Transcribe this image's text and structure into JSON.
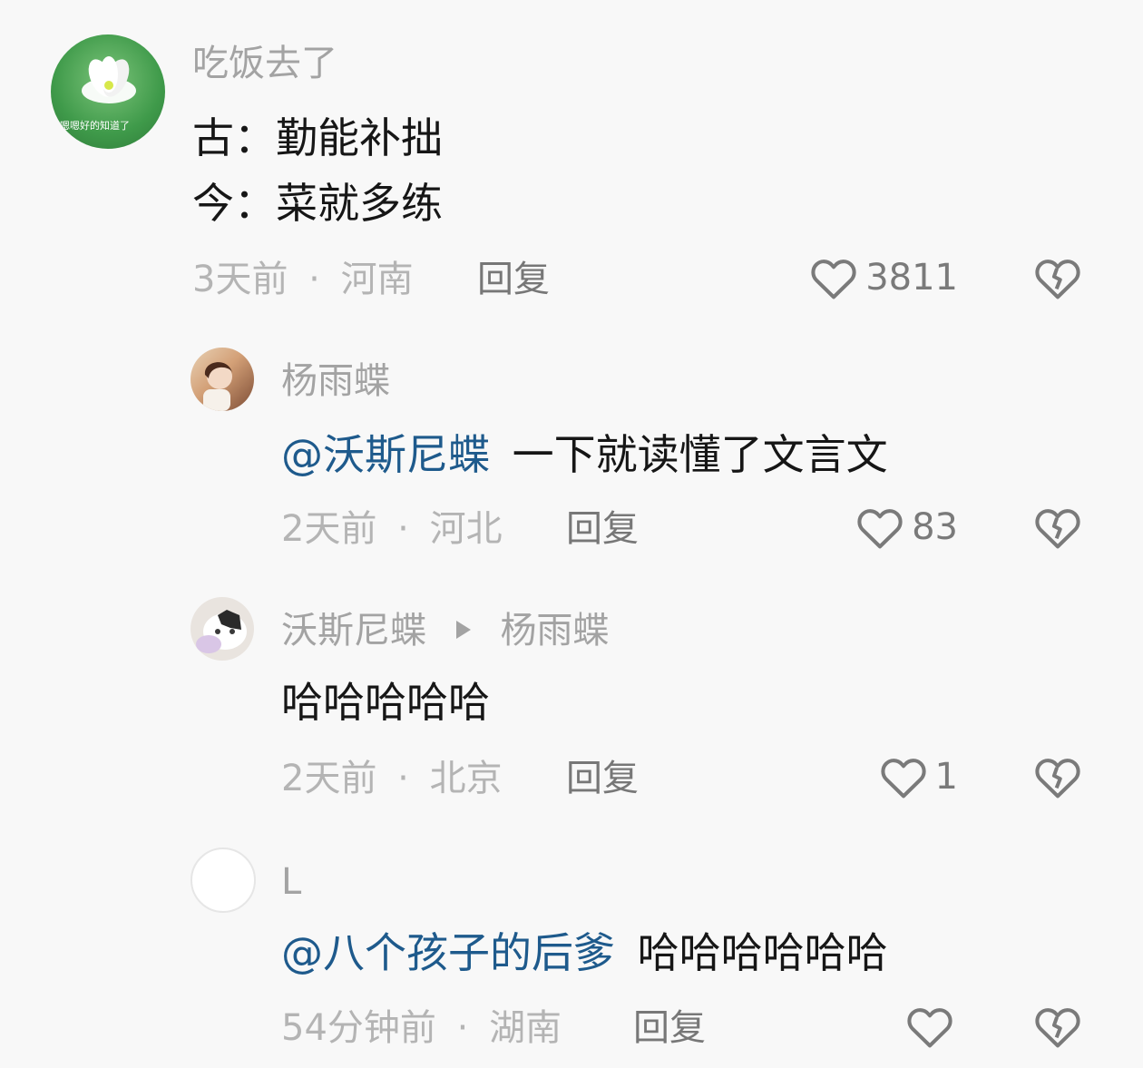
{
  "comments": [
    {
      "username": "吃饭去了",
      "avatar_text": "嗯嗯好的知道了",
      "lines": [
        "古：勤能补拙",
        "今：菜就多练"
      ],
      "time": "3天前",
      "sep": "·",
      "location": "河南",
      "reply_label": "回复",
      "likes": "3811"
    },
    {
      "username": "杨雨蝶",
      "mention": "@沃斯尼蝶",
      "body": "一下就读懂了文言文",
      "time": "2天前",
      "sep": "·",
      "location": "河北",
      "reply_label": "回复",
      "likes": "83"
    },
    {
      "username": "沃斯尼蝶",
      "reply_to": "杨雨蝶",
      "body": "哈哈哈哈哈",
      "time": "2天前",
      "sep": "·",
      "location": "北京",
      "reply_label": "回复",
      "likes": "1"
    },
    {
      "username": "L",
      "mention": "@八个孩子的后爹",
      "body": "哈哈哈哈哈哈",
      "time": "54分钟前",
      "sep": "·",
      "location": "湖南",
      "reply_label": "回复",
      "likes": ""
    }
  ],
  "icons": {
    "like": "heart-outline-icon",
    "dislike": "broken-heart-icon"
  },
  "colors": {
    "mention": "#1e5a8c",
    "avatar_green": "#3f9a4a"
  }
}
